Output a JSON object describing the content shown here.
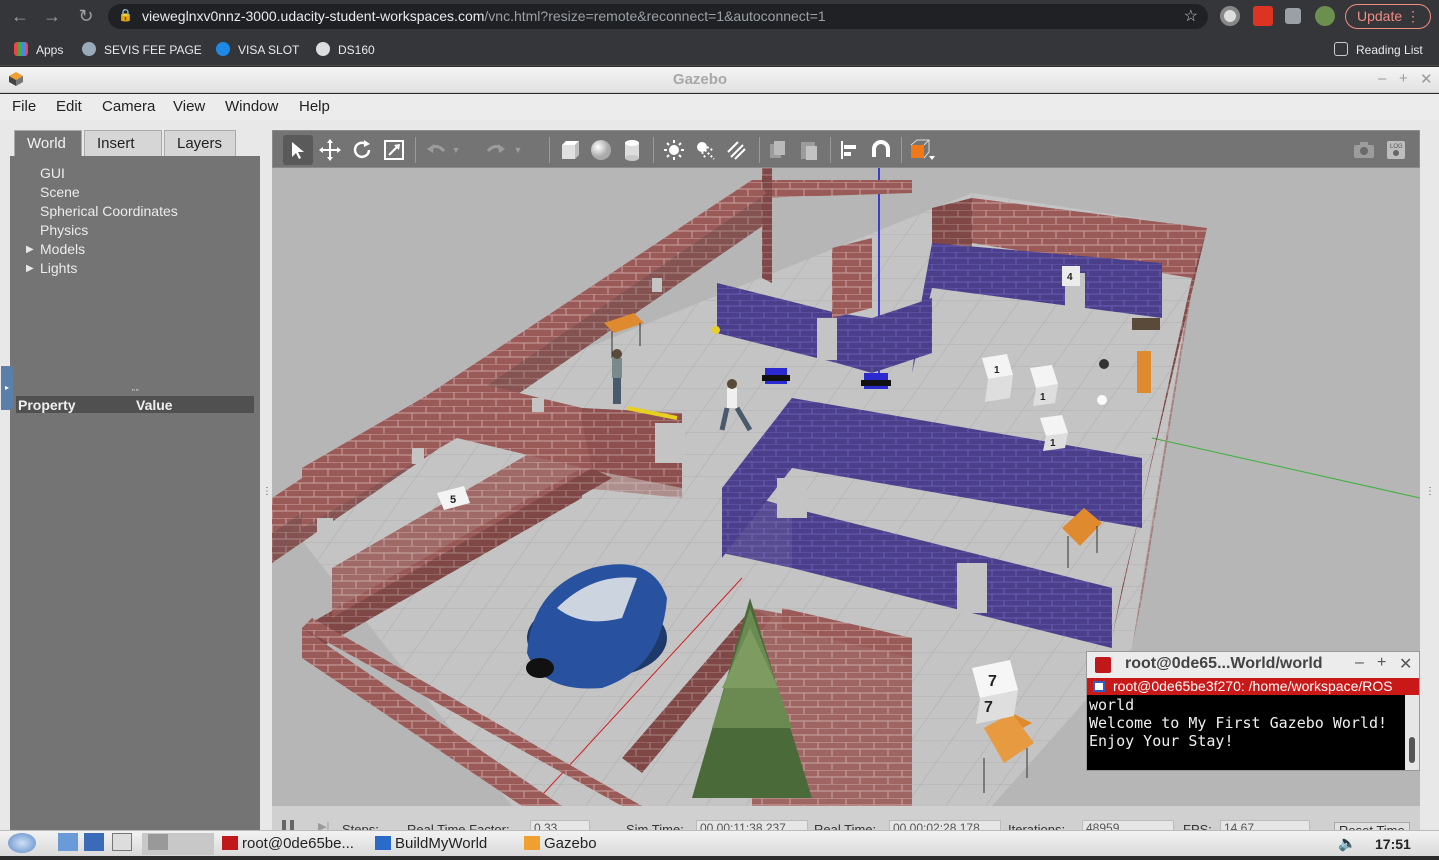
{
  "browser": {
    "url_host": "vieweglnxv0nnz-3000.udacity-student-workspaces.com",
    "url_path": "/vnc.html?resize=remote&reconnect=1&autoconnect=1",
    "update_label": "Update",
    "bookmarks": [
      "Apps",
      "SEVIS FEE PAGE",
      "VISA SLOT",
      "DS160"
    ],
    "reading_list": "Reading List"
  },
  "gazebo": {
    "title": "Gazebo",
    "menu": [
      "File",
      "Edit",
      "Camera",
      "View",
      "Window",
      "Help"
    ],
    "tabs": [
      "World",
      "Insert",
      "Layers"
    ],
    "active_tab": "World",
    "tree": [
      {
        "label": "GUI",
        "expandable": false
      },
      {
        "label": "Scene",
        "expandable": false
      },
      {
        "label": "Spherical Coordinates",
        "expandable": false
      },
      {
        "label": "Physics",
        "expandable": false
      },
      {
        "label": "Models",
        "expandable": true
      },
      {
        "label": "Lights",
        "expandable": true
      }
    ],
    "property_header": "Property",
    "value_header": "Value",
    "status": {
      "steps": "Steps:",
      "rtf_label": "Real Time Factor:",
      "rtf": "0.33",
      "sim_time_label": "Sim Time:",
      "sim_time": "00 00:11:38.237",
      "real_time_label": "Real Time:",
      "real_time": "00 00:02:28.178",
      "iterations_label": "Iterations:",
      "iterations": "48959",
      "fps_label": "FPS:",
      "fps": "14.67",
      "reset_label": "Reset Time"
    },
    "scene_labels": [
      "1",
      "1",
      "1",
      "4",
      "5",
      "7",
      "7"
    ]
  },
  "terminal": {
    "title": "root@0de65...World/world",
    "tab": "root@0de65be3f270: /home/workspace/ROS",
    "lines": [
      "world",
      "Welcome to My First Gazebo World!",
      "Enjoy Your Stay!"
    ]
  },
  "taskbar": {
    "tasks": [
      "root@0de65be...",
      "BuildMyWorld",
      "Gazebo"
    ],
    "clock": "17:51"
  },
  "colors": {
    "brick": "#9a5a55",
    "purple_wall": "#4a3f8a",
    "floor": "#b4b4b4",
    "terminal_tab": "#c81818"
  }
}
